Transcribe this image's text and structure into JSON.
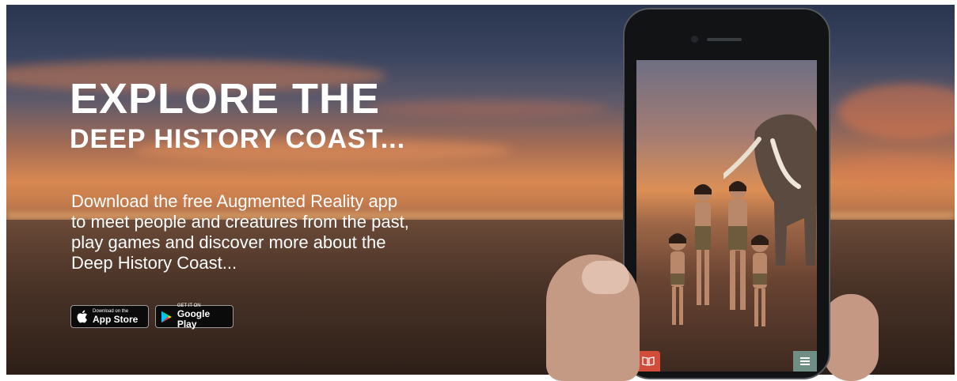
{
  "hero": {
    "title_line1": "EXPLORE THE",
    "title_line2": "DEEP HISTORY COAST...",
    "description_lines": [
      "Download the free Augmented Reality app",
      "to meet people and creatures from the past,",
      "play games and discover more about the",
      "Deep History Coast..."
    ]
  },
  "store_badges": {
    "app_store": {
      "small": "Download on the",
      "big": "App Store",
      "icon": "apple-icon"
    },
    "google_play": {
      "small": "GET IT ON",
      "big": "Google Play",
      "icon": "google-play-icon"
    }
  },
  "phone": {
    "screen_icons": [
      "book-icon",
      "menu-icon"
    ]
  },
  "colors": {
    "accent_red": "#d24c3a",
    "menu_green": "#6f8e84",
    "text": "#ffffff"
  }
}
